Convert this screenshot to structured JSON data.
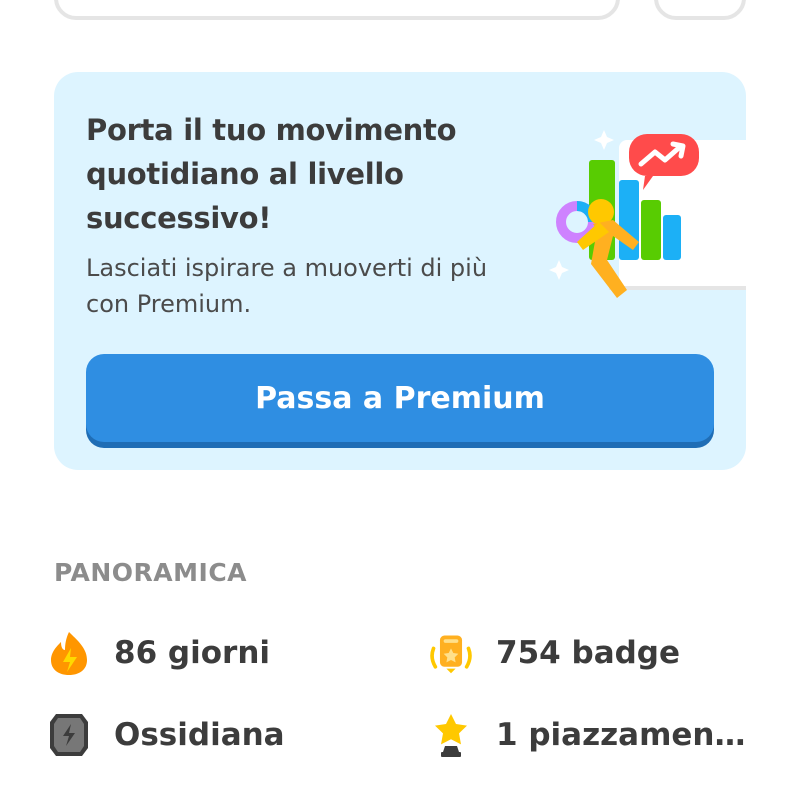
{
  "promo": {
    "title": "Porta il tuo movimento quotidiano al livello successivo!",
    "subtitle": "Lasciati ispirare a muoverti di più con Premium.",
    "button_label": "Passa a Premium",
    "illustration": "running-figure-chart-illustration"
  },
  "overview": {
    "header": "PANORAMICA",
    "stats": [
      {
        "icon": "flame-icon",
        "label": "86 giorni"
      },
      {
        "icon": "badge-icon",
        "label": "754 badge"
      },
      {
        "icon": "obsidian-shield-icon",
        "label": "Ossidiana"
      },
      {
        "icon": "star-trophy-icon",
        "label": "1 piazzament..."
      }
    ]
  },
  "colors": {
    "promo_bg": "#ddf4ff",
    "button": "#2f8ee2",
    "button_shadow": "#1f6db5",
    "section_header": "#8c8c8c",
    "text": "#3c3c3c"
  }
}
